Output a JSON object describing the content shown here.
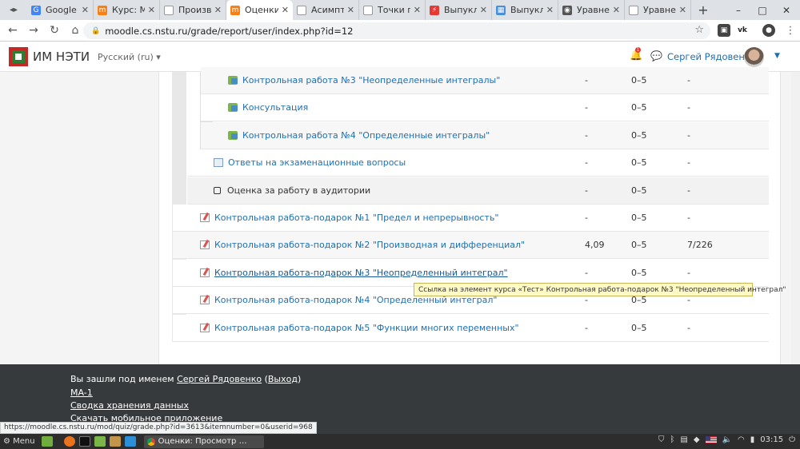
{
  "browser": {
    "tabs": [
      {
        "label": "Google",
        "favicon_color": "#4285f4",
        "favicon_glyph": "G"
      },
      {
        "label": "Курс: Ма",
        "favicon_color": "#f98012",
        "favicon_glyph": "m"
      },
      {
        "label": "Произв",
        "favicon_color": "#ffffff",
        "favicon_glyph": ""
      },
      {
        "label": "Оценки",
        "favicon_color": "#f98012",
        "favicon_glyph": "m"
      },
      {
        "label": "Асимпт",
        "favicon_color": "#ffffff",
        "favicon_glyph": ""
      },
      {
        "label": "Точки п",
        "favicon_color": "#ffffff",
        "favicon_glyph": ""
      },
      {
        "label": "Выпукл",
        "favicon_color": "#e53935",
        "favicon_glyph": "⚡"
      },
      {
        "label": "Выпукл",
        "favicon_color": "#4a90d9",
        "favicon_glyph": "▦"
      },
      {
        "label": "Уравне",
        "favicon_color": "#555555",
        "favicon_glyph": "◉"
      },
      {
        "label": "Уравне",
        "favicon_color": "#ffffff",
        "favicon_glyph": ""
      }
    ],
    "new_tab": "+",
    "url": "moodle.cs.nstu.ru/grade/report/user/index.php?id=12",
    "extensions": [
      "ext-1",
      "vk",
      "ext-3"
    ],
    "window_controls": [
      "–",
      "□",
      "✕"
    ]
  },
  "moodle": {
    "site_name": "ИМ НЭТИ",
    "language": "Русский (ru)",
    "notification_count": "1",
    "user_name": "Сергей Рядовенко"
  },
  "grades": [
    {
      "item": "Контрольная работа №3 \"Неопределенные интегралы\"",
      "type": "forum",
      "grade": "-",
      "range": "0–5",
      "rank": "-"
    },
    {
      "item": "Консультация",
      "type": "forum",
      "grade": "-",
      "range": "0–5",
      "rank": "-"
    },
    {
      "item": "Контрольная работа №4 \"Определенные интегралы\"",
      "type": "forum",
      "grade": "-",
      "range": "0–5",
      "rank": "-"
    },
    {
      "item": "Ответы на экзаменационные вопросы",
      "type": "assign",
      "grade": "-",
      "range": "0–5",
      "rank": "-"
    },
    {
      "item": "Оценка за работу в аудитории",
      "type": "manual",
      "grade": "-",
      "range": "0–5",
      "rank": "-"
    },
    {
      "item": "Контрольная работа-подарок №1 \"Предел и непрерывность\"",
      "type": "quiz",
      "grade": "-",
      "range": "0–5",
      "rank": "-"
    },
    {
      "item": "Контрольная работа-подарок №2 \"Производная и дифференциал\"",
      "type": "quiz",
      "grade": "4,09",
      "range": "0–5",
      "rank": "7/226"
    },
    {
      "item": "Контрольная работа-подарок №3 \"Неопределенный интеграл\"",
      "type": "quiz",
      "grade": "-",
      "range": "0–5",
      "rank": "-"
    },
    {
      "item": "Контрольная работа-подарок №4 \"Определенный интеграл\"",
      "type": "quiz",
      "grade": "-",
      "range": "0–5",
      "rank": "-"
    },
    {
      "item": "Контрольная работа-подарок №5 \"Функции многих переменных\"",
      "type": "quiz",
      "grade": "-",
      "range": "0–5",
      "rank": "-"
    }
  ],
  "tooltip": "Ссылка на элемент курса «Тест» Контрольная работа-подарок №3 \"Неопределенный интеграл\"",
  "footer": {
    "logged_in_prefix": "Вы зашли под именем ",
    "logged_in_user": "Сергей Рядовенко",
    "logout_open": " (",
    "logout": "Выход",
    "logout_close": ")",
    "course_link": "MA-1",
    "retention_link": "Сводка хранения данных",
    "mobile_app_link": "Скачать мобильное приложение"
  },
  "status_url": "https://moodle.cs.nstu.ru/mod/quiz/grade.php?id=3613&itemnumber=0&userid=968",
  "taskbar": {
    "menu_label": "Menu",
    "window_title": "Оценки: Просмотр …",
    "clock": "03:15"
  }
}
